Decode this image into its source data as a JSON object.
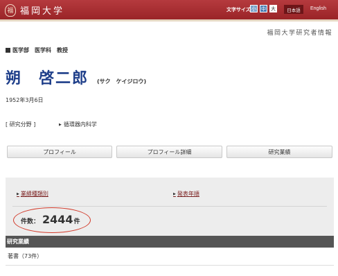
{
  "header": {
    "logo_seal_glyph": "福",
    "logo_text": "福岡大学",
    "font_size_label": "文字サイズ",
    "font_size_small": "小",
    "font_size_medium": "中",
    "font_size_large": "大",
    "lang_japanese": "日本語",
    "lang_english": "English",
    "bar_color": "#9a2427"
  },
  "site_subtitle": "福岡大学研究者情報",
  "profile": {
    "affiliation": "医学部　医学科　教授",
    "name": "朔　啓二郎",
    "name_kana": "(サク　ケイジロウ)",
    "birthdate": "1952年3月6日",
    "field_label": "[ 研究分野 ]",
    "field_value": "循環器内科学",
    "name_color": "#1f3f8a"
  },
  "tabs": [
    {
      "label": "プロフィール"
    },
    {
      "label": "プロフィール詳細"
    },
    {
      "label": "研究業績"
    }
  ],
  "results": {
    "link_by_type": "業績種類別",
    "link_by_year": "発表年順",
    "count_label": "件数：",
    "count_value": "2444",
    "count_unit": "件",
    "highlight_color": "#d23a2a"
  },
  "section": {
    "title": "研究業績",
    "row_books": "著書（73件）"
  }
}
